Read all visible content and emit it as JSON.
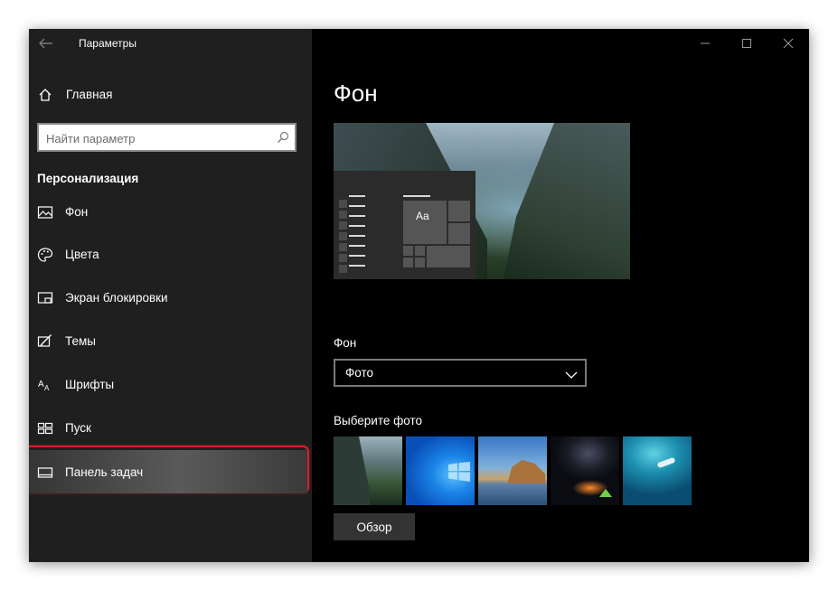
{
  "window": {
    "title": "Параметры",
    "controls": {
      "minimize_icon": "minimize-icon",
      "maximize_icon": "maximize-icon",
      "close_icon": "close-icon"
    }
  },
  "sidebar": {
    "home_label": "Главная",
    "search": {
      "placeholder": "Найти параметр",
      "value": ""
    },
    "section_title": "Персонализация",
    "items": [
      {
        "label": "Фон",
        "icon": "picture-icon"
      },
      {
        "label": "Цвета",
        "icon": "palette-icon"
      },
      {
        "label": "Экран блокировки",
        "icon": "lock-screen-icon"
      },
      {
        "label": "Темы",
        "icon": "themes-icon"
      },
      {
        "label": "Шрифты",
        "icon": "fonts-icon"
      },
      {
        "label": "Пуск",
        "icon": "start-icon"
      },
      {
        "label": "Панель задач",
        "icon": "taskbar-icon",
        "selected": true
      }
    ]
  },
  "main": {
    "title": "Фон",
    "preview": {
      "sample_text": "Aa"
    },
    "background_label": "Фон",
    "background_value": "Фото",
    "choose_photo_label": "Выберите фото",
    "browse_label": "Обзор"
  },
  "colors": {
    "sidebar_bg": "#1f1f1f",
    "main_bg": "#000000",
    "highlight_border": "#d6202d"
  }
}
